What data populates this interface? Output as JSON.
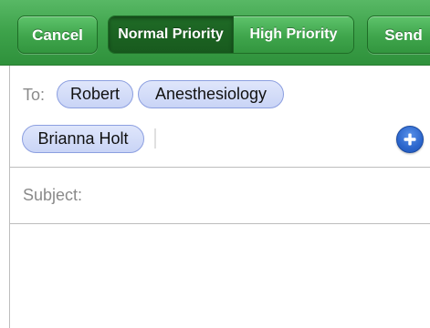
{
  "toolbar": {
    "cancel_label": "Cancel",
    "send_label": "Send",
    "priority": {
      "normal_label": "Normal Priority",
      "high_label": "High Priority",
      "selected": "Normal Priority"
    },
    "accent_color": "#3da24a"
  },
  "recipients": {
    "to_label": "To:",
    "tokens": [
      {
        "label": "Robert"
      },
      {
        "label": "Anesthesiology"
      },
      {
        "label": "Brianna Holt"
      }
    ],
    "add_icon": "plus-circle-icon"
  },
  "subject": {
    "label": "Subject:",
    "value": ""
  },
  "body": {
    "value": ""
  }
}
